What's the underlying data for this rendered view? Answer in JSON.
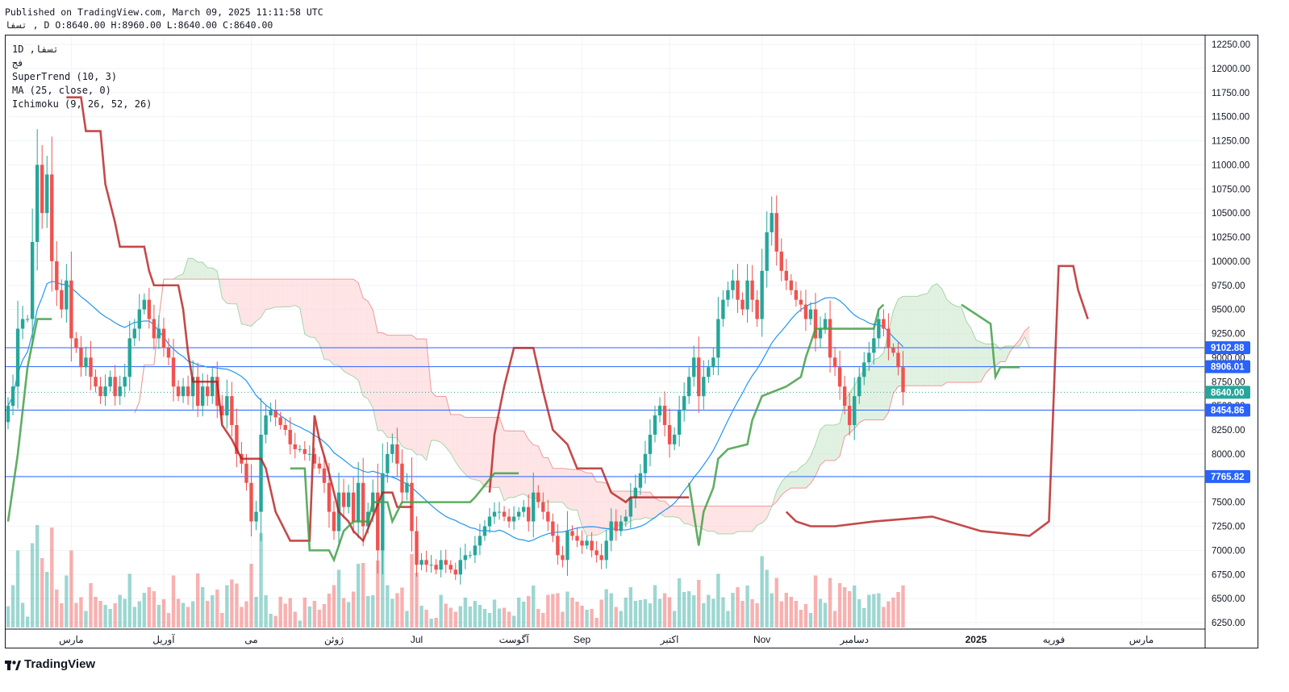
{
  "header": {
    "published": "Published on TradingView.com, March 09, 2025 11:11:58 UTC",
    "ohlc": "تسفا , D O:8640.00 H:8960.00 L:8640.00 C:8640.00"
  },
  "legend": {
    "symbol": "1D ,تسفا",
    "exchange": "فج",
    "indicators": [
      "SuperTrend (10, 3)",
      "MA (25, close, 0)",
      "Ichimoku (9, 26, 52, 26)"
    ]
  },
  "brand": "TradingView",
  "colors": {
    "bull": "#26a69a",
    "bear": "#ef5350",
    "supertrend_down": "#b71c1c",
    "supertrend_up": "#43a047",
    "ma": "#2196f3",
    "hline": "#2962ff",
    "cloud_bull": "#c8e6c9",
    "cloud_bear": "#ffcdd2"
  },
  "chart_data": {
    "type": "candlestick",
    "symbol": "تسفا",
    "timeframe": "1D",
    "ylim": [
      6250,
      12250
    ],
    "y_ticks": [
      6250,
      6500,
      6750,
      7000,
      7250,
      7500,
      7750,
      8000,
      8250,
      8500,
      8750,
      9000,
      9250,
      9500,
      9750,
      10000,
      10250,
      10500,
      10750,
      11000,
      11250,
      11500,
      11750,
      12000,
      12250
    ],
    "y_tick_labels": [
      "6250.00",
      "6500.00",
      "6750.00",
      "7000.00",
      "7250.00",
      "7500.00",
      "7750.00",
      "8000.00",
      "8250.00",
      "8500.00",
      "8750.00",
      "9000.00",
      "9250.00",
      "9500.00",
      "9750.00",
      "10000.00",
      "10250.00",
      "10500.00",
      "10750.00",
      "11000.00",
      "11250.00",
      "11500.00",
      "11750.00",
      "12000.00",
      "12250.00"
    ],
    "x_labels": [
      "مارس",
      "آوریل",
      "می",
      "ژوئن",
      "Jul",
      "آگوست",
      "Sep",
      "اکتبر",
      "Nov",
      "دسامبر",
      "2025",
      "فوریه",
      "مارس"
    ],
    "x_label_bars": [
      13,
      32,
      50,
      67,
      84,
      104,
      118,
      136,
      155,
      174,
      199,
      215,
      233
    ],
    "horizontal_lines": [
      9102.88,
      8906.01,
      8454.86,
      7765.82
    ],
    "price_tags": [
      {
        "value": 9102.88,
        "label": "9102.88",
        "color": "#2962ff"
      },
      {
        "value": 8906.01,
        "label": "8906.01",
        "color": "#2962ff"
      },
      {
        "value": 8640.0,
        "label": "8640.00",
        "color": "#26a69a"
      },
      {
        "value": 8454.86,
        "label": "8454.86",
        "color": "#2962ff"
      },
      {
        "value": 7765.82,
        "label": "7765.82",
        "color": "#2962ff"
      }
    ],
    "last_price": 8640.0,
    "close": [
      8500,
      8700,
      9300,
      9400,
      9400,
      10200,
      11000,
      10500,
      10900,
      10000,
      9700,
      9500,
      9800,
      9200,
      9100,
      8900,
      9000,
      8800,
      8700,
      8600,
      8700,
      8800,
      8600,
      8700,
      8800,
      9200,
      9300,
      9500,
      9600,
      9400,
      9200,
      9300,
      9100,
      9000,
      8700,
      8600,
      8700,
      8600,
      8800,
      8500,
      8700,
      8600,
      8800,
      8500,
      8400,
      8600,
      8300,
      8000,
      7900,
      7700,
      7300,
      7400,
      8200,
      8400,
      8450,
      8380,
      8300,
      8250,
      8100,
      8050,
      8050,
      8000,
      8000,
      7900,
      7850,
      7700,
      7400,
      7200,
      7600,
      7450,
      7600,
      7300,
      7700,
      7250,
      7400,
      7600,
      7000,
      7800,
      8000,
      8100,
      7900,
      7600,
      7700,
      7200,
      6850,
      6900,
      6850,
      6850,
      6800,
      6900,
      6850,
      6800,
      6750,
      6900,
      6950,
      6950,
      7050,
      7150,
      7250,
      7350,
      7400,
      7400,
      7350,
      7300,
      7350,
      7400,
      7450,
      7300,
      7600,
      7500,
      7400,
      7300,
      7150,
      6950,
      6900,
      7200,
      7150,
      7100,
      7050,
      7100,
      7000,
      6950,
      6900,
      7100,
      7300,
      7200,
      7300,
      7350,
      7550,
      7650,
      7800,
      8000,
      8200,
      8400,
      8500,
      8300,
      8100,
      8200,
      8450,
      8600,
      8800,
      9000,
      8600,
      8800,
      8900,
      9000,
      9400,
      9600,
      9700,
      9800,
      9600,
      9500,
      9800,
      9600,
      9400,
      9900,
      10300,
      10500,
      10100,
      9900,
      9800,
      9700,
      9600,
      9550,
      9400,
      9500,
      9200,
      9300,
      9400,
      9000,
      8900,
      8700,
      8500,
      8300,
      8600,
      8800,
      8950,
      9050,
      9200,
      9400,
      9300,
      9100,
      9050,
      8900,
      8640
    ],
    "supertrend": {
      "down_segments": [
        [
          12,
          11700
        ],
        [
          15,
          11700
        ],
        [
          16,
          11350
        ],
        [
          19,
          11350
        ],
        [
          20,
          10800
        ],
        [
          22,
          10400
        ],
        [
          23,
          10150
        ],
        [
          28,
          10150
        ],
        [
          29,
          9900
        ],
        [
          30,
          9750
        ],
        [
          35,
          9750
        ],
        [
          36,
          9500
        ],
        [
          37,
          9050
        ],
        [
          38,
          8750
        ],
        [
          43,
          8750
        ],
        [
          44,
          8300
        ],
        [
          46,
          8150
        ],
        [
          47,
          8050
        ],
        [
          48,
          7950
        ],
        [
          52,
          7950
        ],
        [
          53,
          7850
        ],
        [
          55,
          7400
        ],
        [
          58,
          7100
        ],
        [
          62,
          7100
        ],
        [
          63,
          8400
        ],
        [
          64,
          8150
        ],
        [
          66,
          7800
        ],
        [
          68,
          7400
        ],
        [
          70,
          7300
        ],
        [
          71,
          7200
        ],
        [
          73,
          7100
        ],
        [
          77,
          7600
        ],
        [
          79,
          7600
        ],
        [
          80,
          7450
        ],
        [
          83,
          7450
        ],
        [
          99,
          7600
        ],
        [
          100,
          8200
        ],
        [
          102,
          8700
        ],
        [
          104,
          9100
        ],
        [
          108,
          9100
        ],
        [
          110,
          8650
        ],
        [
          112,
          8250
        ],
        [
          115,
          8100
        ],
        [
          117,
          7850
        ],
        [
          122,
          7850
        ],
        [
          124,
          7600
        ],
        [
          127,
          7500
        ],
        [
          128,
          7550
        ],
        [
          140,
          7550
        ],
        [
          160,
          7400
        ],
        [
          162,
          7300
        ],
        [
          165,
          7250
        ],
        [
          170,
          7250
        ],
        [
          178,
          7300
        ],
        [
          190,
          7350
        ],
        [
          200,
          7200
        ],
        [
          210,
          7150
        ],
        [
          214,
          7300
        ],
        [
          216,
          9950
        ],
        [
          219,
          9950
        ],
        [
          220,
          9700
        ],
        [
          222,
          9400
        ]
      ],
      "up_segments": [
        [
          0,
          7300
        ],
        [
          2,
          8000
        ],
        [
          4,
          8900
        ],
        [
          6,
          9400
        ],
        [
          9,
          9400
        ],
        [
          58,
          7850
        ],
        [
          61,
          7850
        ],
        [
          62,
          7000
        ],
        [
          66,
          7000
        ],
        [
          67,
          6900
        ],
        [
          69,
          7200
        ],
        [
          71,
          7300
        ],
        [
          74,
          7300
        ],
        [
          75,
          7500
        ],
        [
          78,
          7500
        ],
        [
          79,
          7300
        ],
        [
          81,
          7500
        ],
        [
          90,
          7500
        ],
        [
          95,
          7500
        ],
        [
          96,
          7550
        ],
        [
          100,
          7800
        ],
        [
          105,
          7800
        ],
        [
          140,
          7700
        ],
        [
          142,
          7050
        ],
        [
          143,
          7400
        ],
        [
          145,
          7650
        ],
        [
          146,
          7950
        ],
        [
          148,
          8050
        ],
        [
          152,
          8100
        ],
        [
          153,
          8350
        ],
        [
          155,
          8600
        ],
        [
          160,
          8700
        ],
        [
          163,
          8800
        ],
        [
          164,
          9000
        ],
        [
          166,
          9300
        ],
        [
          170,
          9300
        ],
        [
          178,
          9300
        ],
        [
          179,
          9500
        ],
        [
          180,
          9550
        ],
        [
          196,
          9550
        ],
        [
          202,
          9350
        ],
        [
          203,
          8800
        ],
        [
          204,
          8900
        ],
        [
          208,
          8900
        ]
      ]
    }
  }
}
